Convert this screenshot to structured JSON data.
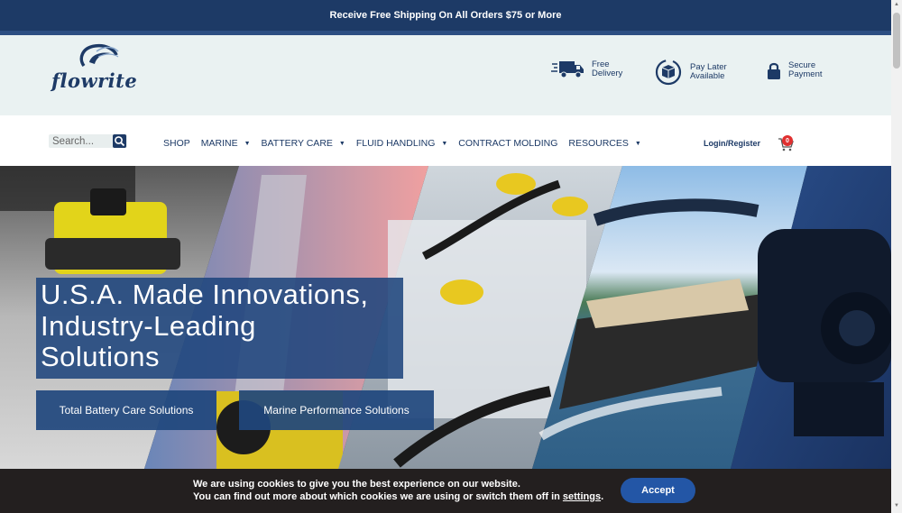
{
  "promo": {
    "text": "Receive Free Shipping On All Orders $75 or More"
  },
  "header": {
    "logo_text": "flowrite",
    "features": [
      {
        "icon": "delivery-truck-icon",
        "line1": "Free",
        "line2": "Delivery"
      },
      {
        "icon": "box-cycle-icon",
        "line1": "Pay Later",
        "line2": "Available"
      },
      {
        "icon": "lock-icon",
        "line1": "Secure",
        "line2": "Payment"
      }
    ]
  },
  "nav": {
    "search_placeholder": "Search...",
    "items": [
      {
        "label": "SHOP",
        "dropdown": false
      },
      {
        "label": "MARINE",
        "dropdown": true
      },
      {
        "label": "BATTERY CARE",
        "dropdown": true
      },
      {
        "label": "FLUID HANDLING",
        "dropdown": true
      },
      {
        "label": "CONTRACT MOLDING",
        "dropdown": false
      },
      {
        "label": "RESOURCES",
        "dropdown": true
      }
    ],
    "login_label": "Login/Register",
    "cart_count": "0"
  },
  "hero": {
    "headline_lines": [
      "U.S.A. Made Innovations,",
      "Industry-Leading",
      "Solutions"
    ],
    "buttons": [
      {
        "label": "Total Battery Care Solutions"
      },
      {
        "label": "Marine Performance Solutions"
      }
    ]
  },
  "cookie": {
    "line1": "We are using cookies to give you the best experience on our website.",
    "line2_prefix": "You can find out more about which cookies we are using or switch them off in ",
    "settings_link": "settings",
    "line2_suffix": ".",
    "accept_label": "Accept"
  },
  "colors": {
    "navy": "#1d3a66",
    "accent_blue": "#2356a6",
    "header_bg": "#eaf2f2",
    "cookie_bg": "#231f1f"
  }
}
